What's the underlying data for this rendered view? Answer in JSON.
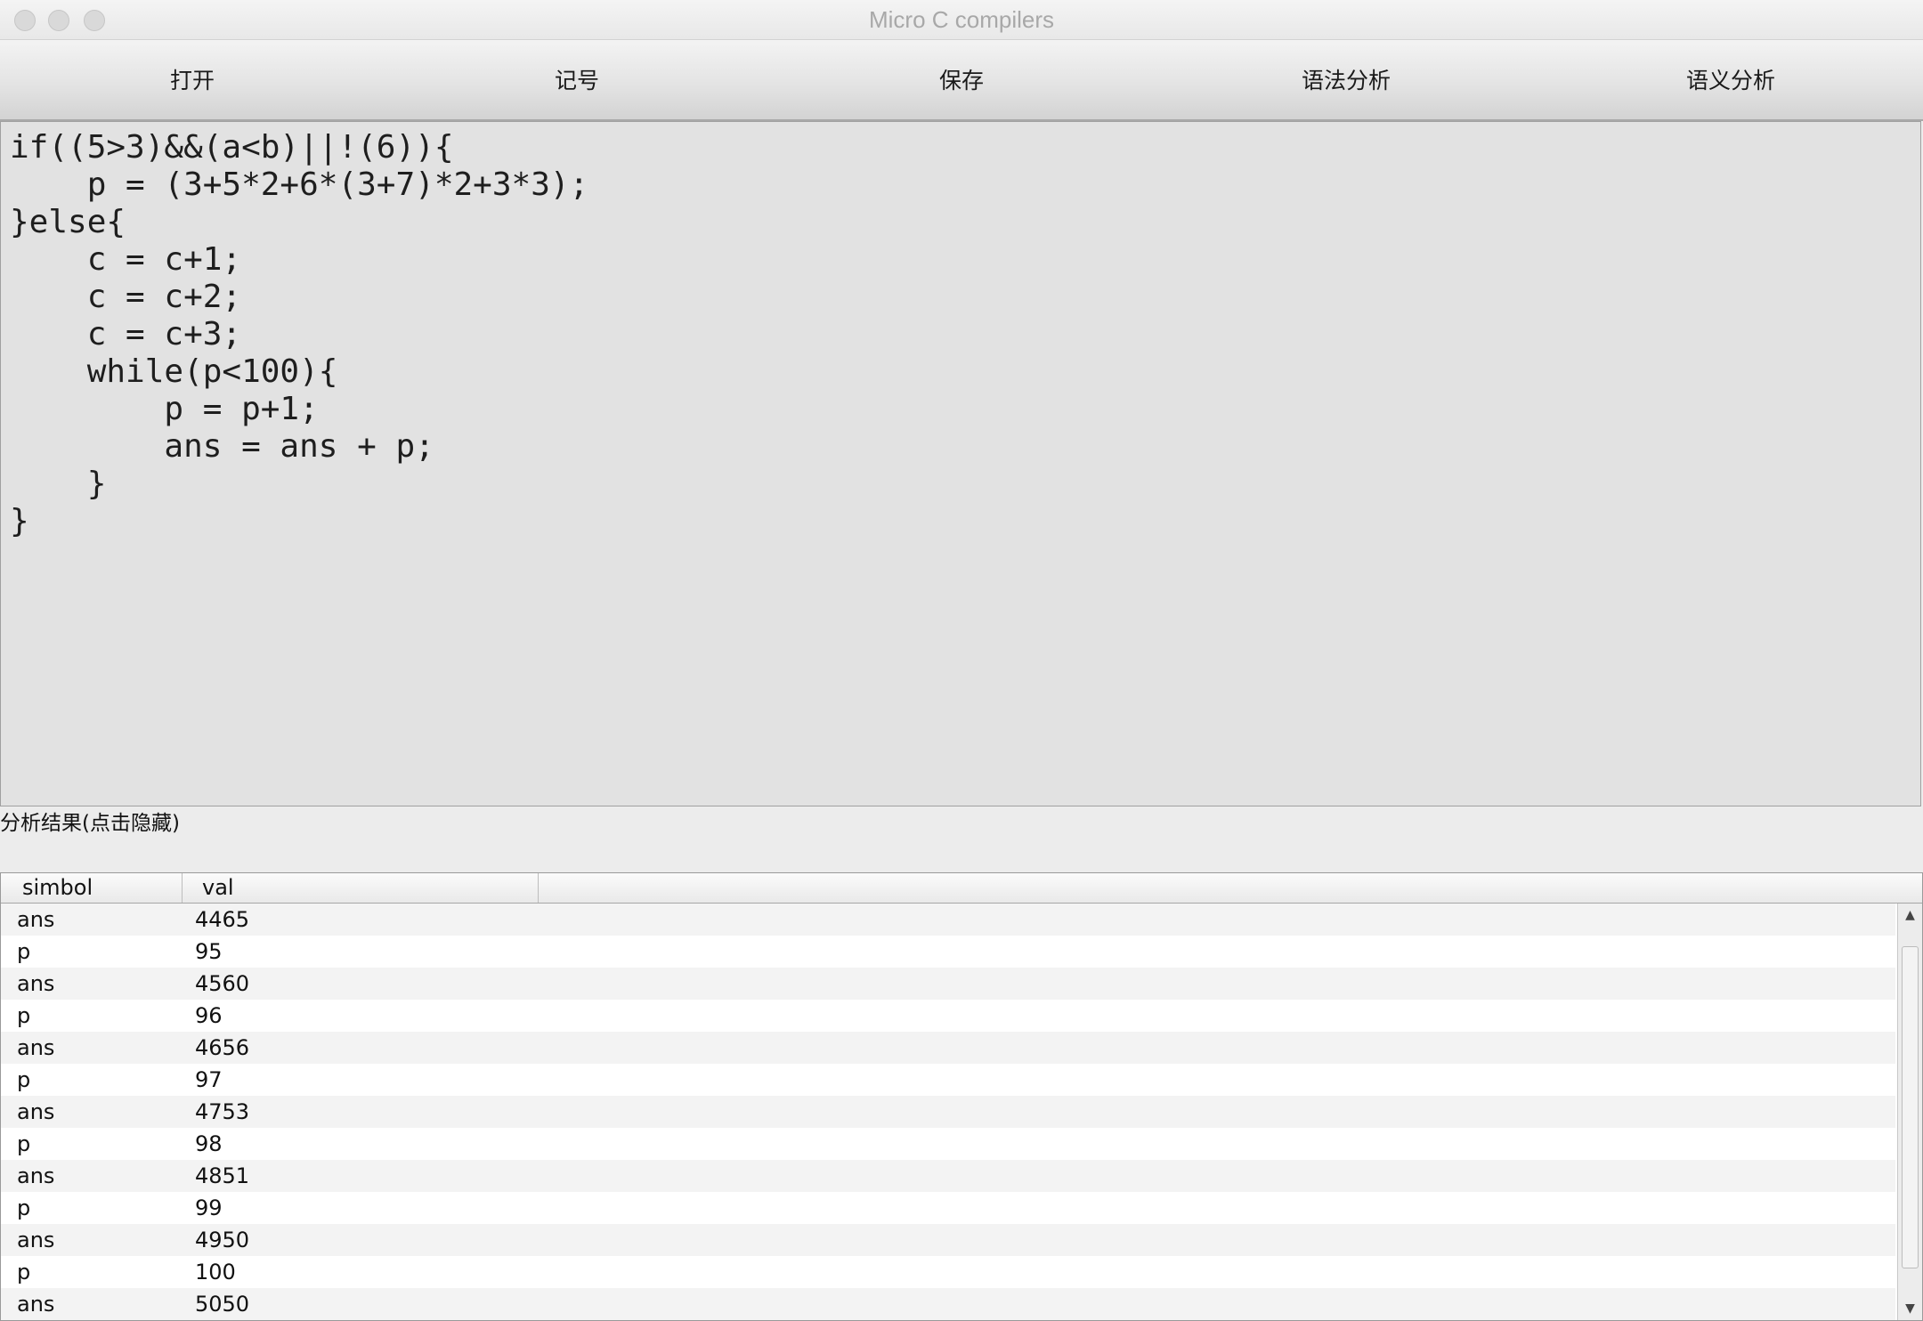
{
  "window": {
    "title": "Micro C compilers"
  },
  "toolbar": {
    "buttons": [
      {
        "label": "打开"
      },
      {
        "label": "记号"
      },
      {
        "label": "保存"
      },
      {
        "label": "语法分析"
      },
      {
        "label": "语义分析"
      }
    ]
  },
  "editor": {
    "code": "if((5>3)&&(a<b)||!(6)){\n    p = (3+5*2+6*(3+7)*2+3*3);\n}else{\n    c = c+1;\n    c = c+2;\n    c = c+3;\n    while(p<100){\n        p = p+1;\n        ans = ans + p;\n    }\n}"
  },
  "results": {
    "label": "分析结果(点击隐藏)",
    "columns": [
      "simbol",
      "val",
      ""
    ],
    "rows": [
      [
        "ans",
        "4465"
      ],
      [
        "p",
        "95"
      ],
      [
        "ans",
        "4560"
      ],
      [
        "p",
        "96"
      ],
      [
        "ans",
        "4656"
      ],
      [
        "p",
        "97"
      ],
      [
        "ans",
        "4753"
      ],
      [
        "p",
        "98"
      ],
      [
        "ans",
        "4851"
      ],
      [
        "p",
        "99"
      ],
      [
        "ans",
        "4950"
      ],
      [
        "p",
        "100"
      ],
      [
        "ans",
        "5050"
      ]
    ]
  }
}
